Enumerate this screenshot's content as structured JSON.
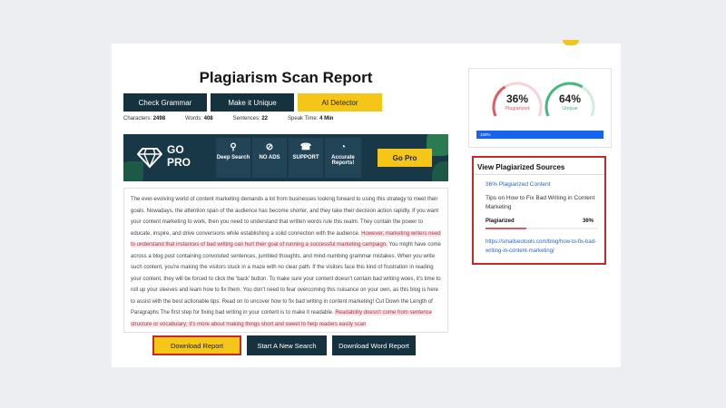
{
  "report": {
    "title": "Plagiarism Scan Report",
    "buttons": {
      "check_grammar": "Check Grammar",
      "make_unique": "Make it Unique",
      "ai_detector": "AI Detector"
    },
    "stats": {
      "characters_label": "Characters:",
      "characters": "2498",
      "words_label": "Words:",
      "words": "408",
      "sentences_label": "Sentences:",
      "sentences": "22",
      "speak_label": "Speak Time:",
      "speak": "4 Min"
    },
    "banner": {
      "go": "GO",
      "pro": "PRO",
      "features": [
        {
          "icon": "search-icon",
          "glyph": "🔍",
          "label": "Deep Search"
        },
        {
          "icon": "no-ads-icon",
          "glyph": "⊘",
          "label": "NO ADS"
        },
        {
          "icon": "support-icon",
          "glyph": "☊",
          "label": "SUPPORT"
        },
        {
          "icon": "pie-chart-icon",
          "glyph": "◔",
          "label": "Accurate Reports!"
        }
      ],
      "cta": "Go Pro"
    },
    "text": {
      "p1": "The ever-evolving world of content marketing demands a lot from businesses looking forward to using this strategy to meet their goals. Nowadays, the attention span of the audience has become shorter, and they take their decision action rapidly. If you want your content marketing to work, then you need to understand that written words rule this realm. They contain the power to educate, inspire, and drive conversions while establishing a solid connection with the audience. ",
      "h1": "However, marketing writers need to understand that instances of bad writing can hurt their goal of running a successful marketing campaign.",
      "p2": " You might have come across a blog post containing convoluted sentences, jumbled thoughts, and mind-numbing grammar mistakes. When you write such content, you're making the visitors stuck in a maze with no clear path. If the visitors face this kind of frustration in reading your content, they will be forced to click the 'back' button. To make sure your content doesn't contain bad writing woes, it's time to roll up your sleeves and learn how to fix them. You don't need to fear overcoming this nuisance on your own, as this blog is here to assist with the best actionable tips. Read on to uncover how to fix bad writing in content marketing! Cut Down the Length of Paragraphs The first step for fixing bad writing in your content is to make it readable. ",
      "h2": "Readability doesn't come from sentence structure or vocabulary; it's more about making things short and sweet to help readers easily scan"
    },
    "bottom_buttons": {
      "download": "Download Report",
      "new_search": "Start A New Search",
      "word_report": "Download Word Report"
    }
  },
  "sidebar": {
    "plagiarized_pct": "36%",
    "plagiarized_label": "Plagiarized",
    "plagiarized_value": 0.36,
    "unique_pct": "64%",
    "unique_label": "Unique",
    "unique_value": 0.64,
    "progress_text": "100%",
    "sources": {
      "heading": "View Plagiarized Sources",
      "pct_content": "36% Plagiarized Content",
      "title": "Tips on How to Fix Bad Writing in Content Marketing",
      "plag_label": "Plagiarized",
      "plag_value": "36%",
      "plag_fraction": 0.36,
      "url": "https://smallseotools.com/blog/how-to-fix-bad-writing-in-content-marketing/"
    }
  },
  "colors": {
    "navy": "#16323f",
    "yellow": "#f5c518",
    "red": "#c62828",
    "green": "#43b97f",
    "pink": "#e05a66",
    "blue": "#1464f0"
  }
}
